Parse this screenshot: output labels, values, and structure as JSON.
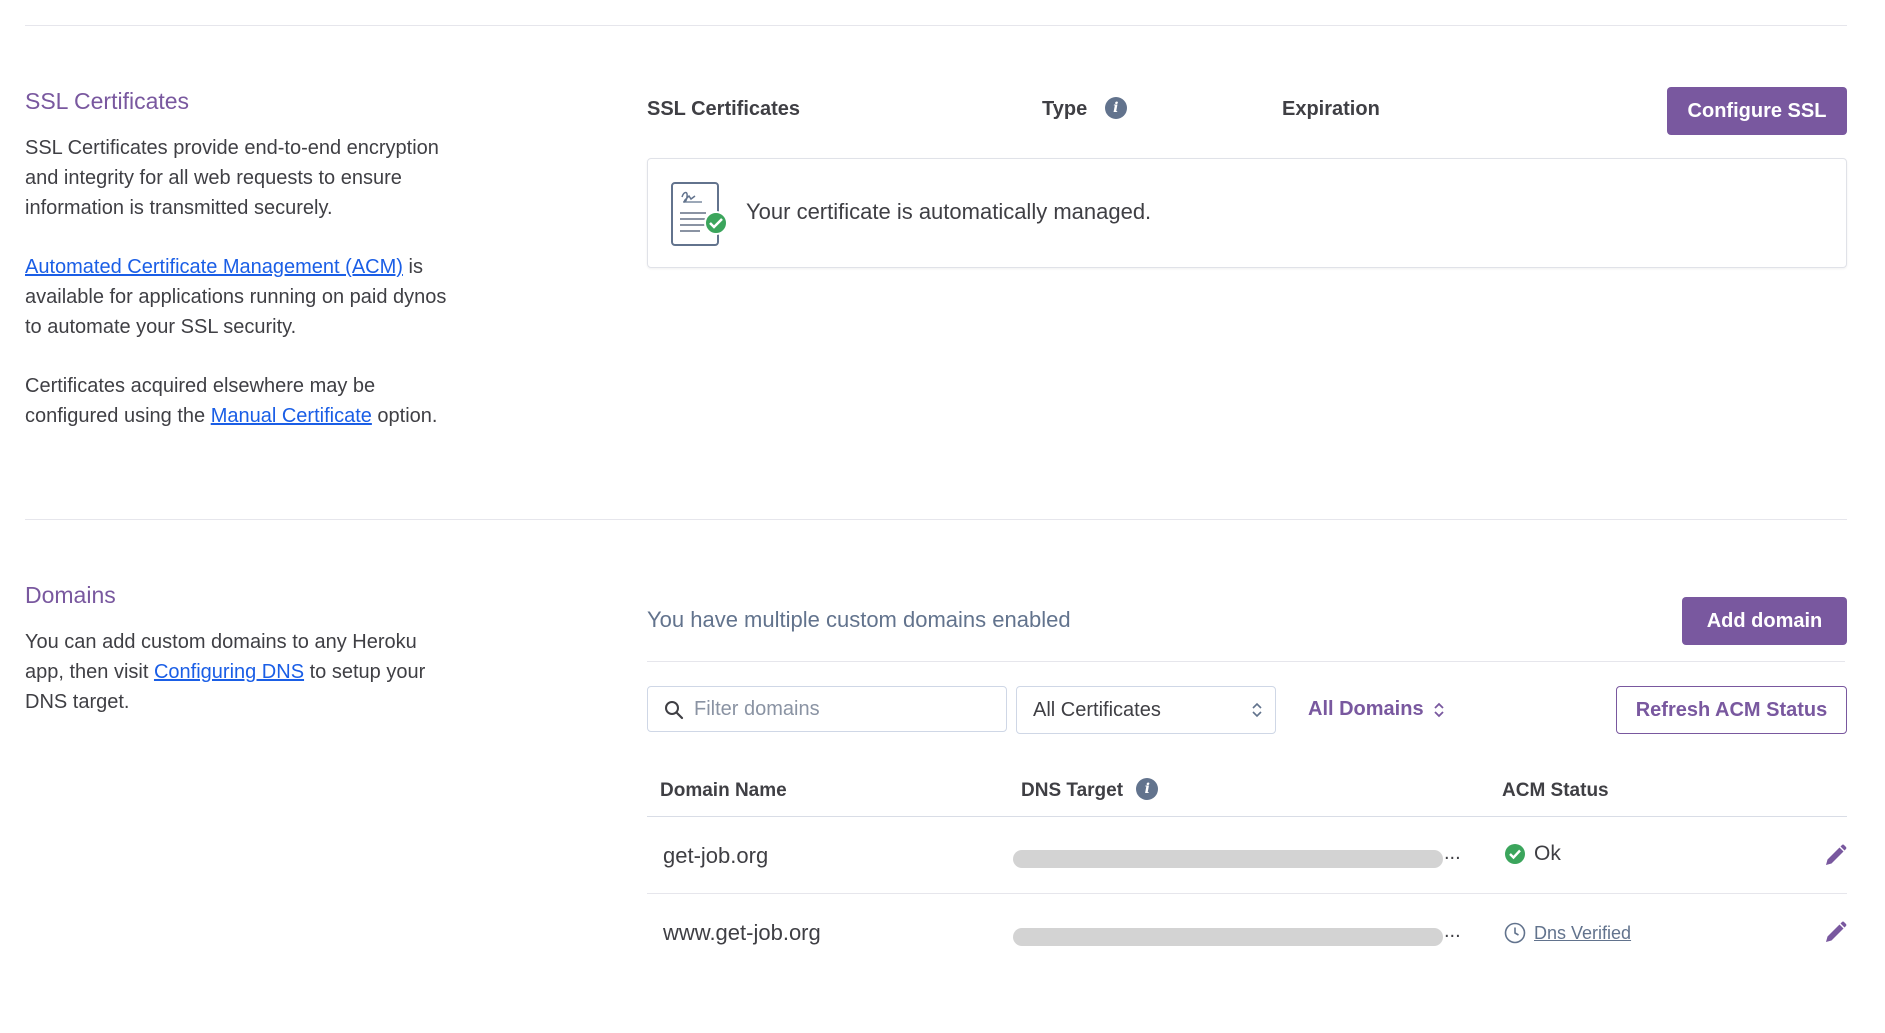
{
  "ssl": {
    "title": "SSL Certificates",
    "desc1": "SSL Certificates provide end-to-end encryption and integrity for all web requests to ensure information is transmitted securely.",
    "acm_link": "Automated Certificate Management (ACM)",
    "desc2_rest": " is available for applications running on paid dynos to automate your SSL security.",
    "desc3_pre": "Certificates acquired elsewhere may be configured using the ",
    "manual_link": "Manual Certificate",
    "desc3_post": " option.",
    "col_certificates": "SSL Certificates",
    "col_type": "Type",
    "col_expiration": "Expiration",
    "configure_button": "Configure SSL",
    "managed_text": "Your certificate is automatically managed."
  },
  "domains": {
    "title": "Domains",
    "desc_pre": "You can add custom domains to any Heroku app, then visit ",
    "dns_link": "Configuring DNS",
    "desc_post": " to setup your DNS target.",
    "multiple_text": "You have multiple custom domains enabled",
    "add_button": "Add domain",
    "filter_placeholder": "Filter domains",
    "cert_select": "All Certificates",
    "all_domains": "All Domains",
    "refresh_button": "Refresh ACM Status",
    "columns": [
      "Domain Name",
      "DNS Target",
      "ACM Status"
    ],
    "rows": [
      {
        "name": "get-job.org",
        "dns_tail": "...",
        "status": "Ok",
        "status_icon": "check-circle-icon"
      },
      {
        "name": "www.get-job.org",
        "dns_tail": "...",
        "status": "Dns Verified",
        "status_icon": "clock-icon"
      }
    ]
  },
  "colors": {
    "accent": "#79589f",
    "link": "#1a5ee6",
    "ok": "#3ba55c"
  }
}
